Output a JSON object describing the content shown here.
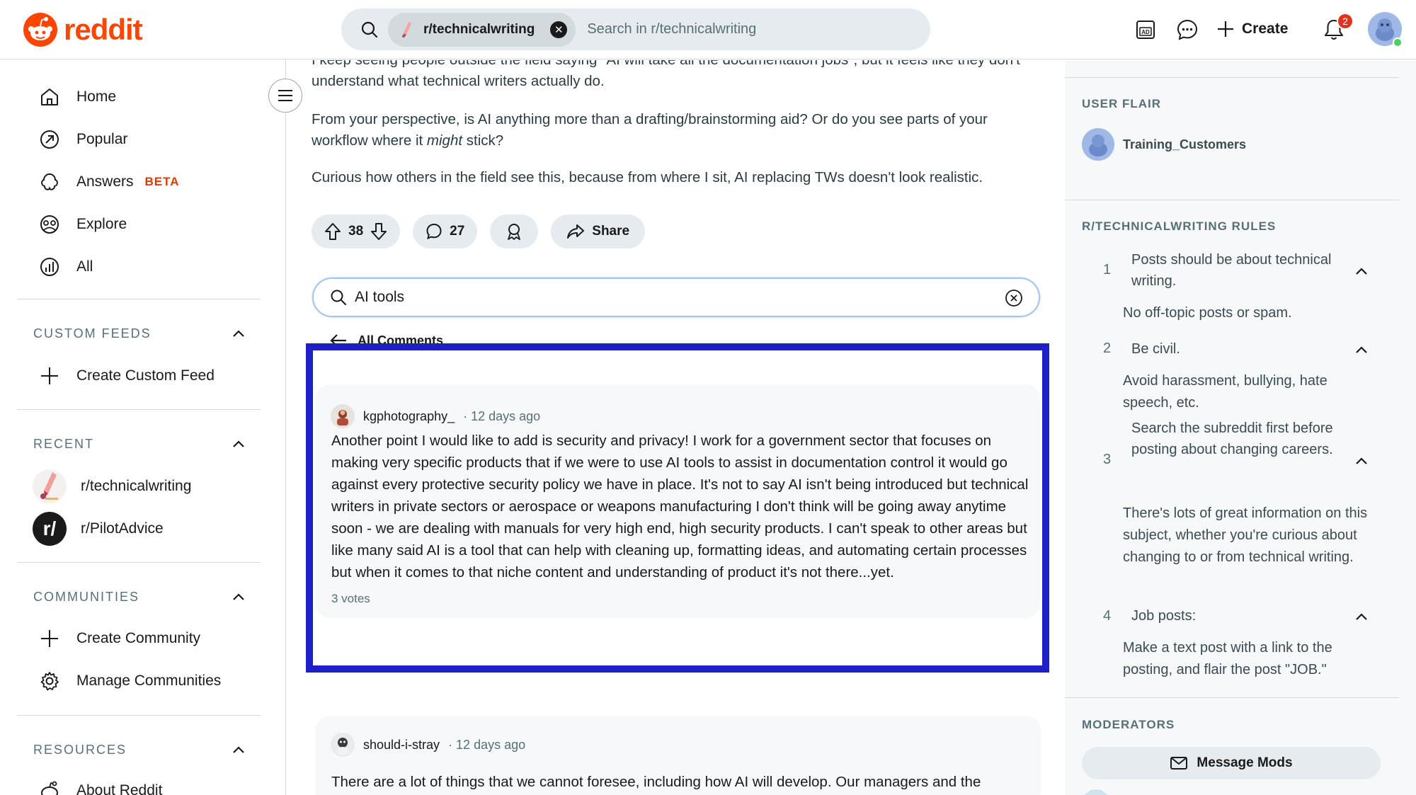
{
  "header": {
    "logo_text": "reddit",
    "search_chip": "r/technicalwriting",
    "search_placeholder": "Search in r/technicalwriting",
    "create_label": "Create",
    "notification_count": "2"
  },
  "left_nav": {
    "items": [
      {
        "label": "Home",
        "icon": "home-icon"
      },
      {
        "label": "Popular",
        "icon": "popular-icon"
      },
      {
        "label": "Answers",
        "icon": "answers-icon",
        "badge": "BETA"
      },
      {
        "label": "Explore",
        "icon": "explore-icon"
      },
      {
        "label": "All",
        "icon": "all-icon"
      }
    ],
    "custom_feeds": {
      "heading": "CUSTOM FEEDS",
      "create_label": "Create Custom Feed"
    },
    "recent": {
      "heading": "RECENT",
      "items": [
        "r/technicalwriting",
        "r/PilotAdvice"
      ]
    },
    "communities": {
      "heading": "COMMUNITIES",
      "create_label": "Create Community",
      "manage_label": "Manage Communities"
    },
    "resources": {
      "heading": "RESOURCES",
      "about_label": "About Reddit"
    }
  },
  "post": {
    "paragraph_top": "I keep seeing people outside the field saying \"AI will take all the documentation jobs\", but it feels like they don't understand what technical writers actually do.",
    "paragraph_2_a": "From your perspective, is AI anything more than a drafting/brainstorming aid? Or do you see parts of your workflow where it ",
    "paragraph_2_em": "might",
    "paragraph_2_b": " stick?",
    "paragraph_3": "Curious how others in the field see this, because from where I sit, AI replacing TWs doesn't look realistic.",
    "votes": "38",
    "comments": "27",
    "share_label": "Share"
  },
  "comment_search": {
    "value": "AI tools",
    "all_comments_label": "All Comments"
  },
  "comments": [
    {
      "user": "kgphotography_",
      "time": "· 12 days ago",
      "body": "Another point I would like to add is security and privacy! I work for a government sector that focuses on making very specific products that if we were to use AI tools to assist in documentation control it would go against every protective security policy we have in place. It's not to say AI isn't being introduced but technical writers in private sectors or aerospace or weapons manufacturing I don't think will be going away anytime soon - we are dealing with manuals for very high end, high security products. I can't speak to other areas but like many said AI is a tool that can help with cleaning up, formatting ideas, and automating certain processes but when it comes to that niche content and understanding of product it's not there...yet.",
      "votes": "3 votes"
    },
    {
      "user": "should-i-stray",
      "time": "· 12 days ago",
      "body": "There are a lot of things that we cannot foresee, including how AI will develop. Our managers and the"
    }
  ],
  "right_sidebar": {
    "user_flair": {
      "heading": "USER FLAIR",
      "name": "Training_Customers"
    },
    "rules": {
      "heading": "R/TECHNICALWRITING RULES",
      "items": [
        {
          "num": "1",
          "title": "Posts should be about technical writing.",
          "desc": "No off-topic posts or spam."
        },
        {
          "num": "2",
          "title": "Be civil.",
          "desc": "Avoid harassment, bullying, hate speech, etc."
        },
        {
          "num": "3",
          "title": "Search the subreddit first before posting about changing careers.",
          "desc": "There's lots of great information on this subject, whether you're curious about changing to or from technical writing."
        },
        {
          "num": "4",
          "title": "Job posts:",
          "desc": "Make a text post with a link to the posting, and flair the post \"JOB.\""
        }
      ]
    },
    "moderators": {
      "heading": "MODERATORS",
      "message_label": "Message Mods"
    }
  },
  "colors": {
    "brand": "#ff4500",
    "highlight_box": "#1f1fc9",
    "beta": "#d93a00"
  }
}
